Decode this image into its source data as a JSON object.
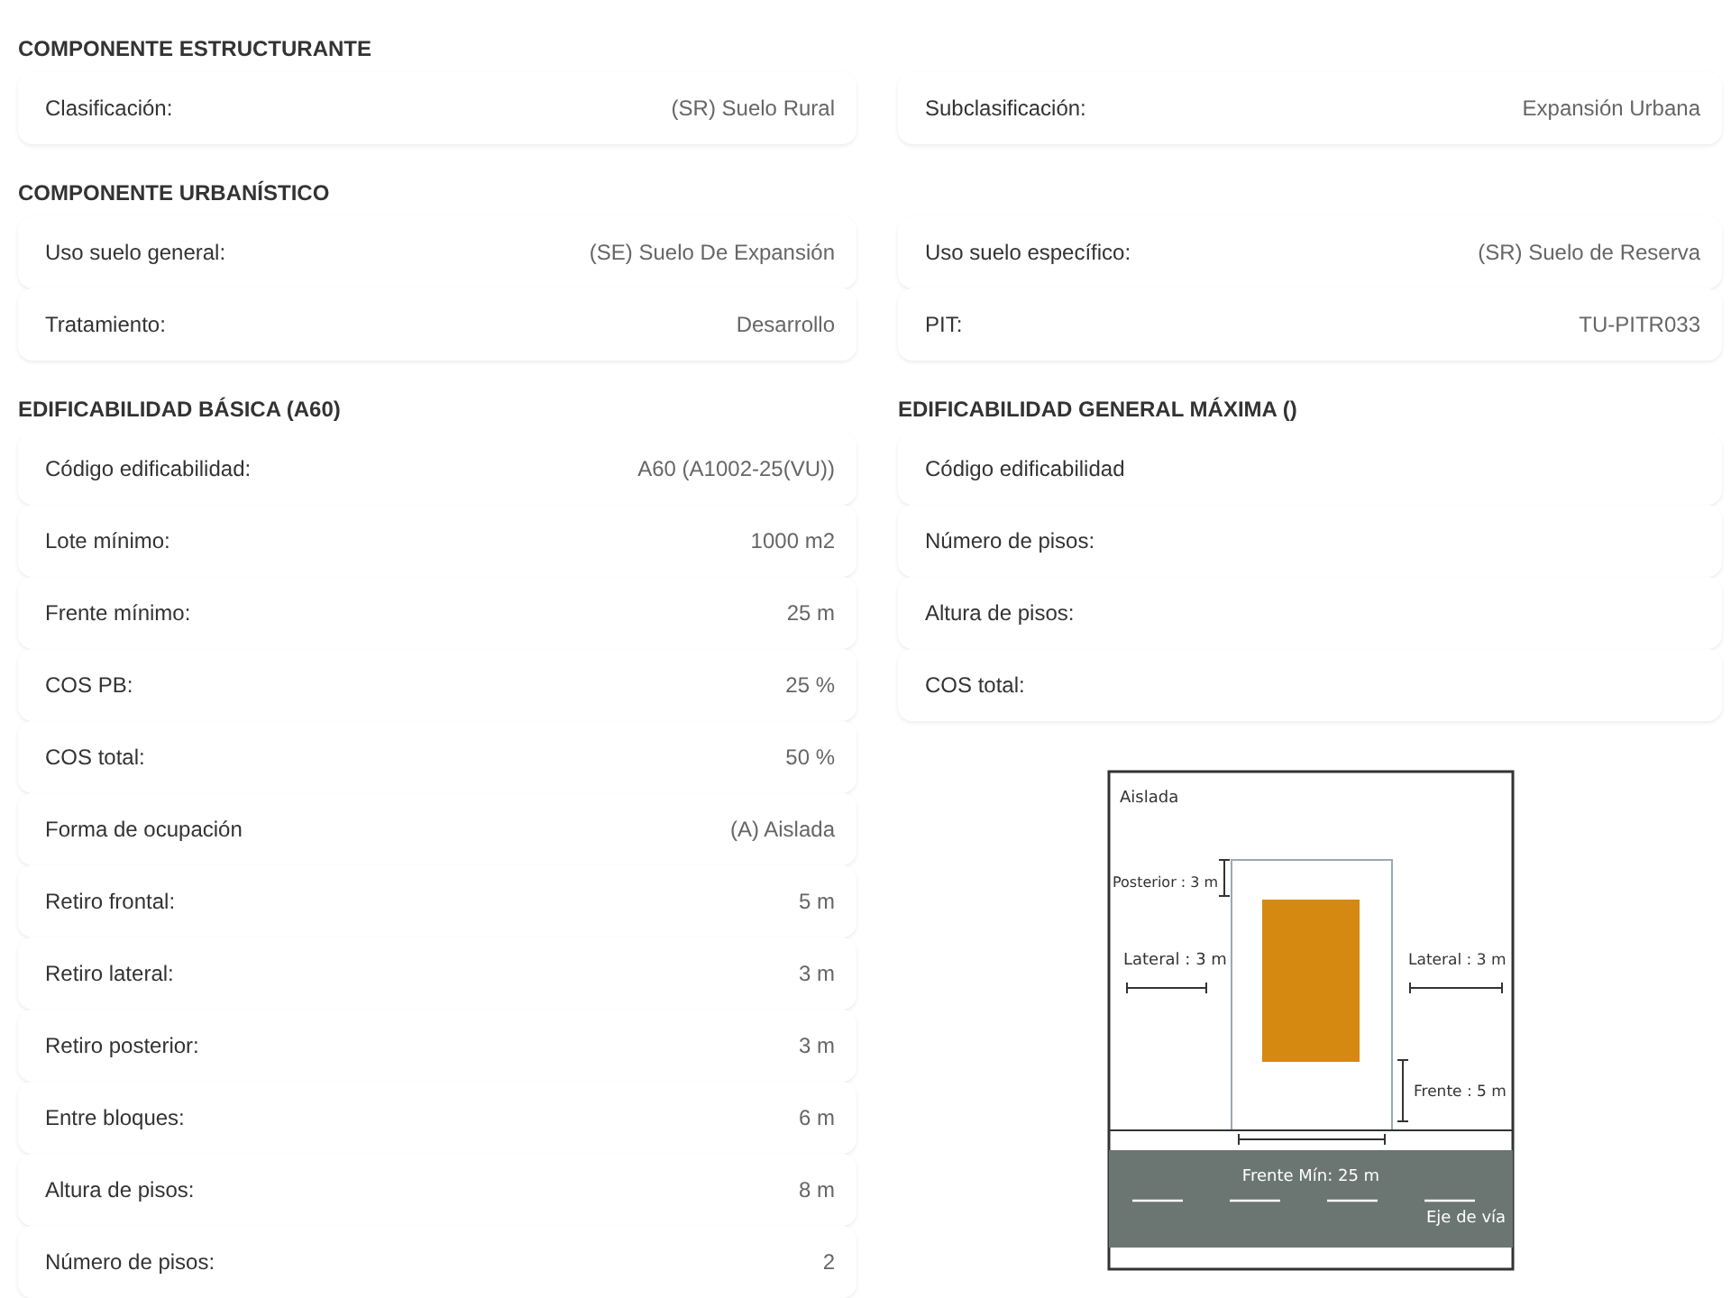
{
  "top_sections": [
    {
      "title": "COMPONENTE ESTRUCTURANTE",
      "rows": [
        {
          "left": {
            "label": "Clasificación:",
            "value": "(SR) Suelo Rural"
          },
          "right": {
            "label": "Subclasificación:",
            "value": "Expansión Urbana"
          }
        }
      ]
    },
    {
      "title": "COMPONENTE URBANÍSTICO",
      "rows": [
        {
          "left": {
            "label": "Uso suelo general:",
            "value": "(SE) Suelo De Expansión"
          },
          "right": {
            "label": "Uso suelo específico:",
            "value": "(SR) Suelo de Reserva"
          }
        },
        {
          "left": {
            "label": "Tratamiento:",
            "value": "Desarrollo"
          },
          "right": {
            "label": "PIT:",
            "value": "TU-PITR033"
          }
        }
      ]
    }
  ],
  "panels": [
    {
      "title": "EDIFICABILIDAD BÁSICA (A60)",
      "rows": [
        {
          "label": "Código edificabilidad:",
          "value": "A60 (A1002-25(VU))"
        },
        {
          "label": "Lote mínimo:",
          "value": "1000 m2"
        },
        {
          "label": "Frente mínimo:",
          "value": "25 m"
        },
        {
          "label": "COS PB:",
          "value": "25 %"
        },
        {
          "label": "COS total:",
          "value": "50 %"
        },
        {
          "label": "Forma de ocupación",
          "value": "(A) Aislada"
        },
        {
          "label": "Retiro frontal:",
          "value": "5 m"
        },
        {
          "label": "Retiro lateral:",
          "value": "3 m"
        },
        {
          "label": "Retiro posterior:",
          "value": "3 m"
        },
        {
          "label": "Entre bloques:",
          "value": "6 m"
        },
        {
          "label": "Altura de pisos:",
          "value": "8 m"
        },
        {
          "label": "Número de pisos:",
          "value": "2"
        }
      ]
    },
    {
      "title": "EDIFICABILIDAD GENERAL MÁXIMA ()",
      "rows": [
        {
          "label": "Código edificabilidad"
        },
        {
          "label": "Número de pisos:"
        },
        {
          "label": "Altura de pisos:"
        },
        {
          "label": "COS total:"
        }
      ],
      "diagram": {
        "title": "Aislada",
        "posterior": "Posterior : 3 m",
        "lateral_left": "Lateral : 3 m",
        "lateral_right": "Lateral : 3 m",
        "front": "Frente : 5 m",
        "front_min": "Frente Mín: 25 m",
        "axis": "Eje de vía"
      }
    }
  ]
}
